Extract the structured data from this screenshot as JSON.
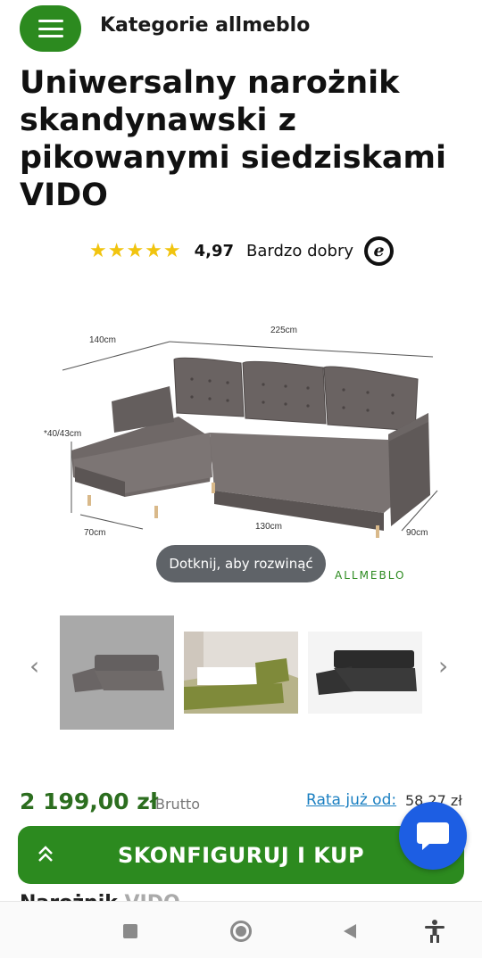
{
  "header": {
    "category_label": "Kategorie allmeblo",
    "menu_icon": "hamburger-icon"
  },
  "product": {
    "title": "Uniwersalny narożnik skandynawski z pikowanymi siedziskami VIDO"
  },
  "rating": {
    "stars": "★★★★★",
    "score": "4,97",
    "verdict": "Bardzo dobry",
    "badge_letter": "e"
  },
  "image": {
    "tap_hint": "Dotknij, aby rozwinąć",
    "brand_logo": "ALLMEBLO",
    "dims": {
      "top": "225cm",
      "side": "140cm",
      "height": "*40/43cm",
      "bottom": "130cm",
      "left": "70cm",
      "right": "90cm"
    }
  },
  "gallery": {
    "prev_icon": "‹",
    "next_icon": "›"
  },
  "price": {
    "amount": "2 199,00 zł",
    "brutto": "Brutto",
    "rate_link": "Rata już od:",
    "rate_value": "58,27 zł"
  },
  "cta": {
    "label": "SKONFIGURUJ I KUP"
  },
  "peek": {
    "text_dark": "Narożnik ",
    "text_gray": "VIDO"
  },
  "colors": {
    "brand_green": "#2c8a1f",
    "price_green": "#2c6e1f",
    "chat_blue": "#1d5ee3",
    "link_blue": "#1a7fc1",
    "star_yellow": "#f1c40f"
  }
}
